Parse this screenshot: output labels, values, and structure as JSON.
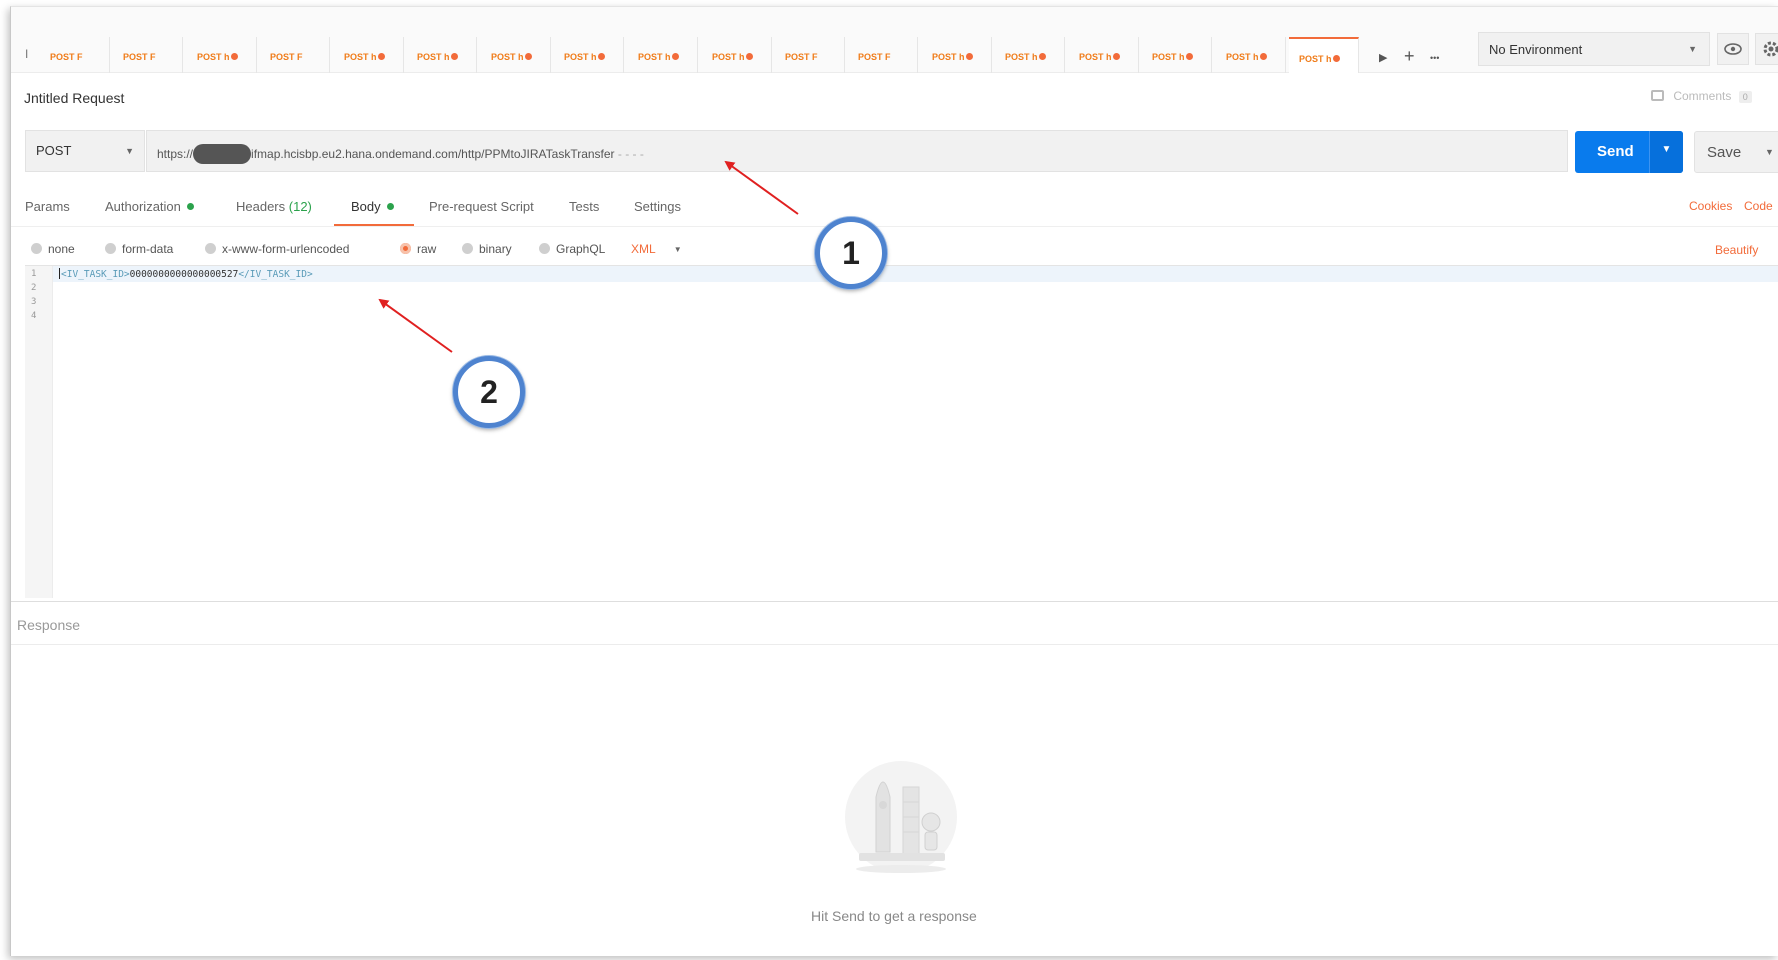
{
  "tabbar": {
    "edge_char": "I",
    "tabs": [
      {
        "label": "POST F",
        "unsaved": false
      },
      {
        "label": "POST F",
        "unsaved": false
      },
      {
        "label": "POST h",
        "unsaved": true
      },
      {
        "label": "POST F",
        "unsaved": false
      },
      {
        "label": "POST h",
        "unsaved": true
      },
      {
        "label": "POST h",
        "unsaved": true
      },
      {
        "label": "POST h",
        "unsaved": true
      },
      {
        "label": "POST h",
        "unsaved": true
      },
      {
        "label": "POST h",
        "unsaved": true
      },
      {
        "label": "POST h",
        "unsaved": true
      },
      {
        "label": "POST F",
        "unsaved": false
      },
      {
        "label": "POST F",
        "unsaved": false
      },
      {
        "label": "POST h",
        "unsaved": true
      },
      {
        "label": "POST h",
        "unsaved": true
      },
      {
        "label": "POST h",
        "unsaved": true
      },
      {
        "label": "POST h",
        "unsaved": true
      },
      {
        "label": "POST h",
        "unsaved": true
      },
      {
        "label": "POST h",
        "unsaved": true
      }
    ],
    "active_tab_index": 17,
    "scroll_glyph": "▶",
    "add_glyph": "+",
    "more_glyph": "•••",
    "environment": "No Environment"
  },
  "request": {
    "name": "Jntitled Request",
    "comments_label": "Comments",
    "comments_count": "0",
    "method": "POST",
    "url_prefix": "https://",
    "url_suffix": "ifmap.hcisbp.eu2.hana.ondemand.com/http/PPMtoJIRATaskTransfer",
    "url_trail": " - - - -",
    "send_label": "Send",
    "save_label": "Save"
  },
  "request_tabs": {
    "params": "Params",
    "authorization": "Authorization",
    "headers": "Headers",
    "headers_count": "(12)",
    "body": "Body",
    "prerequest": "Pre-request Script",
    "tests": "Tests",
    "settings": "Settings",
    "cookies": "Cookies",
    "code": "Code"
  },
  "body_types": {
    "none": "none",
    "form_data": "form-data",
    "urlencoded": "x-www-form-urlencoded",
    "raw": "raw",
    "binary": "binary",
    "graphql": "GraphQL",
    "format": "XML",
    "beautify": "Beautify"
  },
  "editor": {
    "line_numbers": [
      "1",
      "2",
      "3",
      "4"
    ],
    "open_tag": "<IV_TASK_ID>",
    "value": "0000000000000000527",
    "close_tag": "</IV_TASK_ID>"
  },
  "response": {
    "label": "Response",
    "hint": "Hit Send to get a response"
  },
  "annotations": {
    "badge_1": "1",
    "badge_2": "2",
    "arrow_color": "#e02020"
  },
  "colors": {
    "accent_orange": "#f26b3a",
    "send_blue": "#097bed",
    "status_green": "#2ba24c",
    "badge_ring": "#4e83cf"
  }
}
